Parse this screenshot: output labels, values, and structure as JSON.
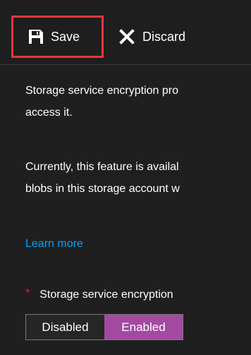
{
  "toolbar": {
    "save_label": "Save",
    "discard_label": "Discard",
    "save_icon": "save-icon",
    "discard_icon": "close-icon"
  },
  "content": {
    "paragraph1": {
      "line1": "Storage service encryption pro",
      "line2": "access it."
    },
    "paragraph2": {
      "line1": "Currently, this feature is availal",
      "line2": "blobs in this storage account w"
    },
    "learn_more": "Learn more",
    "field": {
      "required_marker": "*",
      "label": "Storage service encryption",
      "options": [
        "Disabled",
        "Enabled"
      ],
      "selected": "Enabled"
    }
  },
  "colors": {
    "background": "#1f1f1f",
    "text": "#ffffff",
    "link": "#00a3ff",
    "save_outline": "#e0383e",
    "required_star": "#e31b23",
    "toggle_selected": "#a34aa0"
  }
}
